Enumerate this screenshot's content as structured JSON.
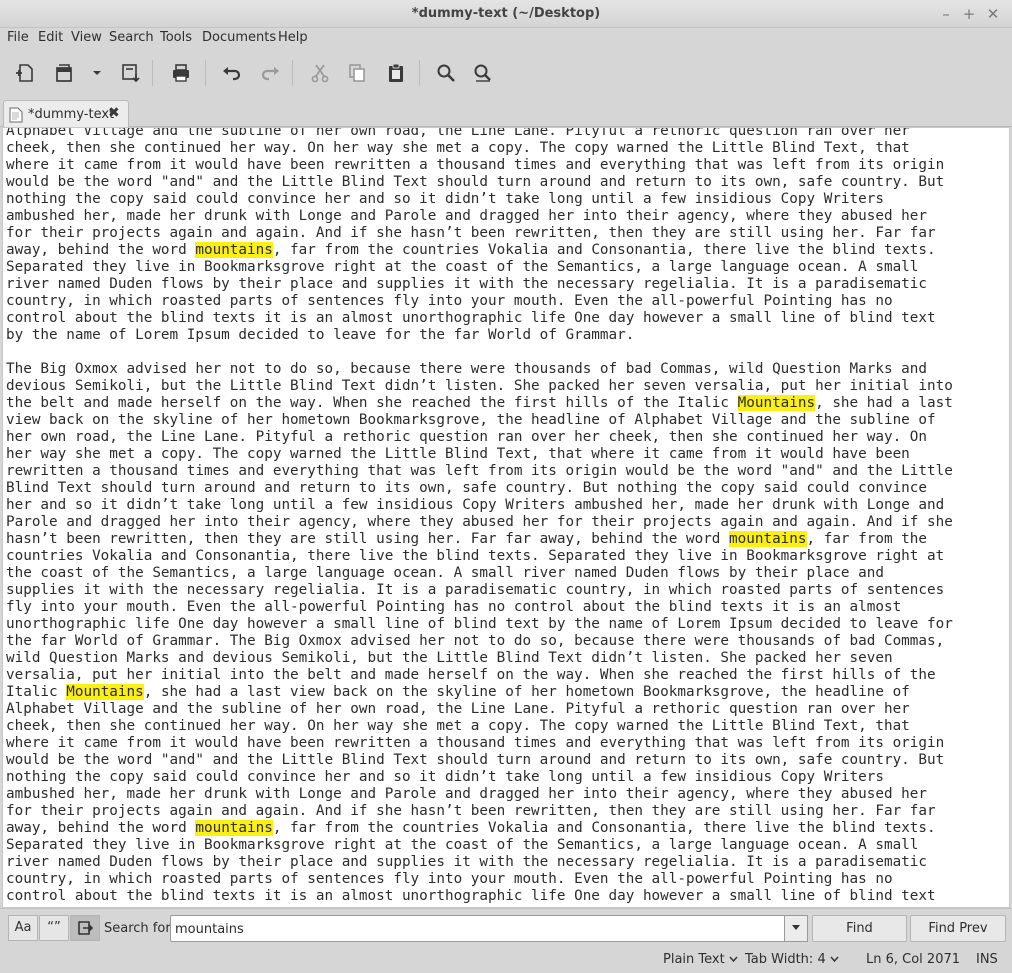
{
  "window": {
    "title": "*dummy-text (~/Desktop)",
    "minimize": "–",
    "maximize": "+",
    "close": "✕"
  },
  "menu": [
    "File",
    "Edit",
    "View",
    "Search",
    "Tools",
    "Documents",
    "Help"
  ],
  "toolbar_icons": [
    "new-document-icon",
    "open-document-icon",
    "open-menu-chevron-icon",
    "save-document-icon",
    "print-icon",
    "undo-icon",
    "redo-icon",
    "cut-icon",
    "copy-icon",
    "paste-icon",
    "find-icon",
    "find-replace-icon"
  ],
  "tab": {
    "label": "*dummy-text",
    "close": "✖"
  },
  "editor": {
    "highlight_color": "#fcef12",
    "lines": [
      "Alphabet Village and the subline of her own road, the Line Lane. Pityful a rethoric question ran over her",
      "cheek, then she continued her way. On her way she met a copy. The copy warned the Little Blind Text, that",
      "where it came from it would have been rewritten a thousand times and everything that was left from its origin",
      "would be the word \"and\" and the Little Blind Text should turn around and return to its own, safe country. But",
      "nothing the copy said could convince her and so it didn’t take long until a few insidious Copy Writers",
      "ambushed her, made her drunk with Longe and Parole and dragged her into their agency, where they abused her",
      "for their projects again and again. And if she hasn’t been rewritten, then they are still using her. Far far",
      "away, behind the word [[mountains]], far from the countries Vokalia and Consonantia, there live the blind texts.",
      "Separated they live in Bookmarksgrove right at the coast of the Semantics, a large language ocean. A small",
      "river named Duden flows by their place and supplies it with the necessary regelialia. It is a paradisematic",
      "country, in which roasted parts of sentences fly into your mouth. Even the all-powerful Pointing has no",
      "control about the blind texts it is an almost unorthographic life One day however a small line of blind text",
      "by the name of Lorem Ipsum decided to leave for the far World of Grammar.",
      "",
      "The Big Oxmox advised her not to do so, because there were thousands of bad Commas, wild Question Marks and",
      "devious Semikoli, but the Little Blind Text didn’t listen. She packed her seven versalia, put her initial into",
      "the belt and made herself on the way. When she reached the first hills of the Italic [[Mountains]], she had a last",
      "view back on the skyline of her hometown Bookmarksgrove, the headline of Alphabet Village and the subline of",
      "her own road, the Line Lane. Pityful a rethoric question ran over her cheek, then she continued her way. On",
      "her way she met a copy. The copy warned the Little Blind Text, that where it came from it would have been",
      "rewritten a thousand times and everything that was left from its origin would be the word \"and\" and the Little",
      "Blind Text should turn around and return to its own, safe country. But nothing the copy said could convince",
      "her and so it didn’t take long until a few insidious Copy Writers ambushed her, made her drunk with Longe and",
      "Parole and dragged her into their agency, where they abused her for their projects again and again. And if she",
      "hasn’t been rewritten, then they are still using her. Far far away, behind the word [[mountains]], far from the",
      "countries Vokalia and Consonantia, there live the blind texts. Separated they live in Bookmarksgrove right at",
      "the coast of the Semantics, a large language ocean. A small river named Duden flows by their place and",
      "supplies it with the necessary regelialia. It is a paradisematic country, in which roasted parts of sentences",
      "fly into your mouth. Even the all-powerful Pointing has no control about the blind texts it is an almost",
      "unorthographic life One day however a small line of blind text by the name of Lorem Ipsum decided to leave for",
      "the far World of Grammar. The Big Oxmox advised her not to do so, because there were thousands of bad Commas,",
      "wild Question Marks and devious Semikoli, but the Little Blind Text didn’t listen. She packed her seven",
      "versalia, put her initial into the belt and made herself on the way. When she reached the first hills of the",
      "Italic [[Mountains]], she had a last view back on the skyline of her hometown Bookmarksgrove, the headline of",
      "Alphabet Village and the subline of her own road, the Line Lane. Pityful a rethoric question ran over her",
      "cheek, then she continued her way. On her way she met a copy. The copy warned the Little Blind Text, that",
      "where it came from it would have been rewritten a thousand times and everything that was left from its origin",
      "would be the word \"and\" and the Little Blind Text should turn around and return to its own, safe country. But",
      "nothing the copy said could convince her and so it didn’t take long until a few insidious Copy Writers",
      "ambushed her, made her drunk with Longe and Parole and dragged her into their agency, where they abused her",
      "for their projects again and again. And if she hasn’t been rewritten, then they are still using her. Far far",
      "away, behind the word [[mountains]], far from the countries Vokalia and Consonantia, there live the blind texts.",
      "Separated they live in Bookmarksgrove right at the coast of the Semantics, a large language ocean. A small",
      "river named Duden flows by their place and supplies it with the necessary regelialia. It is a paradisematic",
      "country, in which roasted parts of sentences fly into your mouth. Even the all-powerful Pointing has no",
      "control about the blind texts it is an almost unorthographic life One day however a small line of blind text"
    ]
  },
  "search": {
    "case_option": "Aa",
    "quote_option": "“”",
    "wrap_option_icon": "wrap-around-icon",
    "label": "Search for:",
    "value": "mountains",
    "find": "Find",
    "find_prev": "Find Prev"
  },
  "status": {
    "language": "Plain Text",
    "tab_width": "Tab Width:",
    "tab_width_value": "4",
    "position": "Ln 6, Col 2071",
    "mode": "INS"
  }
}
